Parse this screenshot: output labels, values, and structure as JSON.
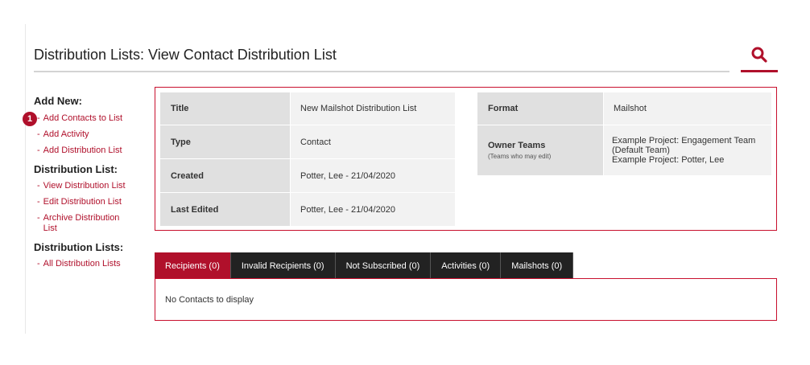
{
  "header": {
    "title": "Distribution Lists: View Contact Distribution List",
    "search_icon": "search-icon",
    "accent": "#b0102b"
  },
  "sidebar": {
    "add_new": {
      "heading": "Add New:",
      "badge": "1",
      "items": [
        "Add Contacts to List",
        "Add Activity",
        "Add Distribution List"
      ]
    },
    "distribution_list": {
      "heading": "Distribution List:",
      "items": [
        "View Distribution List",
        "Edit Distribution List",
        "Archive Distribution List"
      ]
    },
    "distribution_lists": {
      "heading": "Distribution Lists:",
      "items": [
        "All Distribution Lists"
      ]
    }
  },
  "details": {
    "title_label": "Title",
    "title_value": "New Mailshot Distribution List",
    "type_label": "Type",
    "type_value": "Contact",
    "created_label": "Created",
    "created_value": "Potter, Lee - 21/04/2020",
    "edited_label": "Last Edited",
    "edited_value": "Potter, Lee - 21/04/2020",
    "format_label": "Format",
    "format_value": "Mailshot",
    "owner_label": "Owner Teams",
    "owner_sublabel": "(Teams who may edit)",
    "owner_values": [
      "Example Project: Engagement Team",
      "(Default Team)",
      "Example Project: Potter, Lee"
    ]
  },
  "tabs": [
    {
      "label": "Recipients (0)",
      "active": true
    },
    {
      "label": "Invalid Recipients (0)",
      "active": false
    },
    {
      "label": "Not Subscribed (0)",
      "active": false
    },
    {
      "label": "Activities (0)",
      "active": false
    },
    {
      "label": "Mailshots (0)",
      "active": false
    }
  ],
  "tab_content": {
    "empty_message": "No Contacts to display"
  }
}
